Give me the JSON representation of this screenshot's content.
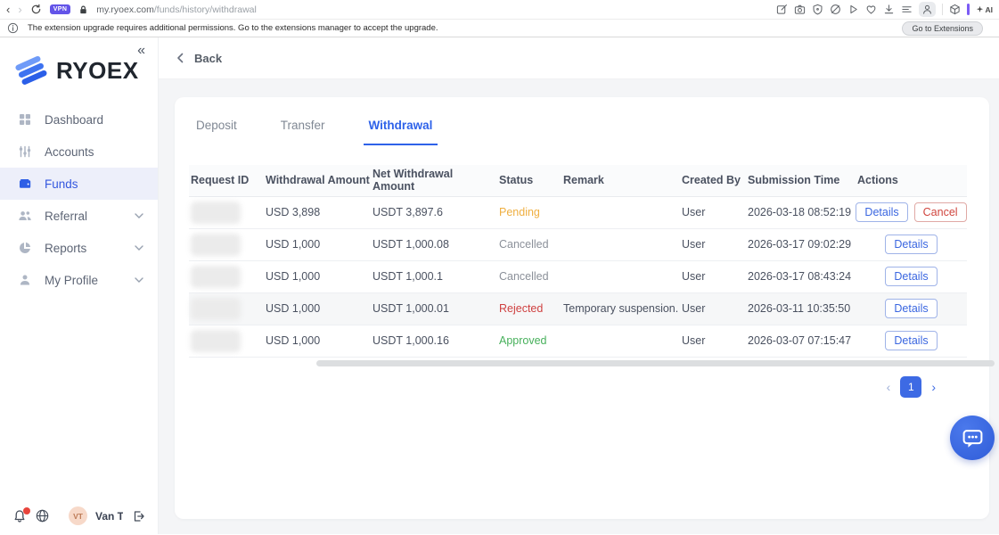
{
  "browser": {
    "url_domain": "my.ryoex.com",
    "url_path": "/funds/history/withdrawal",
    "vpn_badge_label": "VPN",
    "ai_label": "AI",
    "icons": [
      "back-icon",
      "forward-icon",
      "reload-icon",
      "lock-icon",
      "pen-icon",
      "camera-icon",
      "shield-icon",
      "globe-slash-icon",
      "play-icon",
      "heart-icon",
      "download-icon",
      "list-icon",
      "person-icon",
      "cube-icon",
      "sparkle-ai-icon"
    ]
  },
  "notification": {
    "message": "The extension upgrade requires additional permissions. Go to the extensions manager to accept the upgrade.",
    "action_label": "Go to Extensions"
  },
  "sidebar": {
    "brand": "RYOEX",
    "items": [
      {
        "label": "Dashboard",
        "icon": "dashboard-grid-icon",
        "active": false,
        "expandable": false
      },
      {
        "label": "Accounts",
        "icon": "sliders-icon",
        "active": false,
        "expandable": false
      },
      {
        "label": "Funds",
        "icon": "wallet-icon",
        "active": true,
        "expandable": false
      },
      {
        "label": "Referral",
        "icon": "people-icon",
        "active": false,
        "expandable": true
      },
      {
        "label": "Reports",
        "icon": "pie-chart-icon",
        "active": false,
        "expandable": true
      },
      {
        "label": "My Profile",
        "icon": "person-icon",
        "active": false,
        "expandable": true
      }
    ],
    "user": {
      "initials": "VT",
      "name": "Van Ta..."
    }
  },
  "page": {
    "back_label": "Back"
  },
  "tabs": [
    {
      "label": "Deposit",
      "active": false
    },
    {
      "label": "Transfer",
      "active": false
    },
    {
      "label": "Withdrawal",
      "active": true
    }
  ],
  "table": {
    "columns": [
      "Request ID",
      "Withdrawal Amount",
      "Net Withdrawal Amount",
      "Status",
      "Remark",
      "Created By",
      "Submission Time",
      "Actions"
    ],
    "rows": [
      {
        "request_id_redacted": true,
        "withdrawal_amount": "USD 3,898",
        "net_amount": "USDT 3,897.6",
        "status": "Pending",
        "remark": "",
        "created_by": "User",
        "submission_time": "2026-03-18 08:52:19",
        "details_label": "Details",
        "cancel_label": "Cancel"
      },
      {
        "request_id_redacted": true,
        "withdrawal_amount": "USD 1,000",
        "net_amount": "USDT 1,000.08",
        "status": "Cancelled",
        "remark": "",
        "created_by": "User",
        "submission_time": "2026-03-17 09:02:29",
        "details_label": "Details"
      },
      {
        "request_id_redacted": true,
        "withdrawal_amount": "USD 1,000",
        "net_amount": "USDT 1,000.1",
        "status": "Cancelled",
        "remark": "",
        "created_by": "User",
        "submission_time": "2026-03-17 08:43:24",
        "details_label": "Details"
      },
      {
        "request_id_redacted": true,
        "withdrawal_amount": "USD 1,000",
        "net_amount": "USDT 1,000.01",
        "status": "Rejected",
        "remark": "Temporary suspension.",
        "created_by": "User",
        "submission_time": "2026-03-11 10:35:50",
        "details_label": "Details",
        "highlighted": true
      },
      {
        "request_id_redacted": true,
        "withdrawal_amount": "USD 1,000",
        "net_amount": "USDT 1,000.16",
        "status": "Approved",
        "remark": "",
        "created_by": "User",
        "submission_time": "2026-03-07 07:15:47",
        "details_label": "Details"
      }
    ]
  },
  "pagination": {
    "current_page": "1"
  },
  "colors": {
    "accent_blue": "#3d6ae4",
    "tab_active_blue": "#2e62e9",
    "pending_orange": "#efaf41",
    "rejected_red": "#cf4040",
    "approved_green": "#47b05b",
    "cancelled_grey": "#8b9099",
    "cancel_button_red": "#d0453e",
    "vpn_purple": "#6354e8",
    "active_nav_bg": "#edeffa",
    "avatar_bg": "#f7d9c9"
  }
}
